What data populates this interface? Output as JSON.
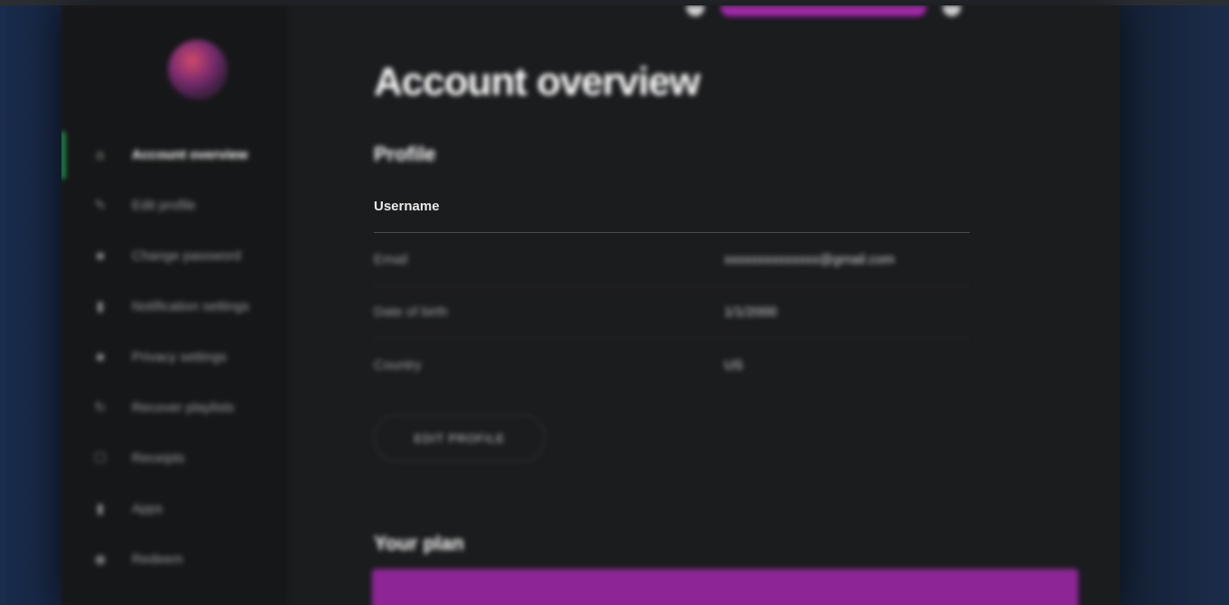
{
  "colors": {
    "accent_green": "#1db954",
    "plan_purple": "#8e2596",
    "topbar_pill": "#a129a8"
  },
  "sidebar": {
    "items": [
      {
        "icon": "home-icon",
        "label": "Account overview",
        "active": true
      },
      {
        "icon": "pencil-icon",
        "label": "Edit profile"
      },
      {
        "icon": "lock-icon",
        "label": "Change password"
      },
      {
        "icon": "bell-icon",
        "label": "Notification settings"
      },
      {
        "icon": "lock-icon",
        "label": "Privacy settings"
      },
      {
        "icon": "refresh-icon",
        "label": "Recover playlists"
      },
      {
        "icon": "receipt-icon",
        "label": "Receipts"
      },
      {
        "icon": "apps-icon",
        "label": "Apps"
      },
      {
        "icon": "question-icon",
        "label": "Redeem"
      }
    ]
  },
  "main": {
    "title": "Account overview",
    "profile_heading": "Profile",
    "profile_rows": [
      {
        "label": "Username",
        "value": ""
      },
      {
        "label": "Email",
        "value": "xxxxxxxxxxxxxx@gmail.com"
      },
      {
        "label": "Date of birth",
        "value": "1/1/2000"
      },
      {
        "label": "Country",
        "value": "US"
      }
    ],
    "edit_button": "EDIT PROFILE",
    "plan_heading": "Your plan"
  }
}
